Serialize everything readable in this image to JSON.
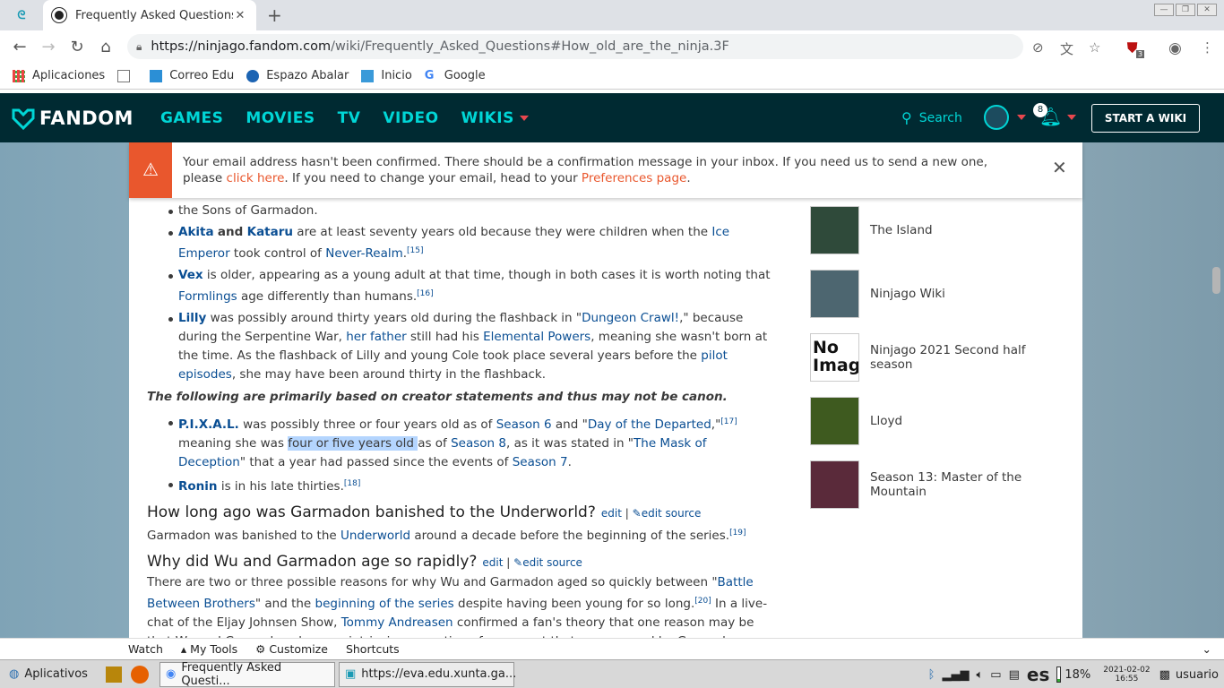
{
  "browser": {
    "tab_title": "Frequently Asked Questions",
    "url_host": "https://ninjago.fandom.com",
    "url_path": "/wiki/Frequently_Asked_Questions#How_old_are_the_ninja.3F",
    "ext_badge": "3"
  },
  "bookmarks": [
    {
      "label": "Aplicaciones"
    },
    {
      "label": ""
    },
    {
      "label": "Correo Edu"
    },
    {
      "label": "Espazo Abalar"
    },
    {
      "label": "Inicio"
    },
    {
      "label": "Google"
    }
  ],
  "fandom": {
    "logo": "FANDOM",
    "nav": [
      "GAMES",
      "MOVIES",
      "TV",
      "VIDEO",
      "WIKIS"
    ],
    "search": "Search",
    "notif_count": "8",
    "start_wiki": "START A WIKI"
  },
  "banner": {
    "text1": "Your email address hasn't been confirmed. There should be a confirmation message in your inbox. If you need us to send a new one, please ",
    "link1": "click here",
    "text2": ". If you need to change your email, head to your ",
    "link2": "Preferences page",
    "text3": "."
  },
  "article": {
    "top_line": "the Sons of Garmadon.",
    "akita": "Akita",
    "and": "and",
    "kataru": "Kataru",
    "akita_t1": " are at least seventy years old because they were children when the ",
    "ice_emperor": "Ice Emperor",
    "akita_t2": " took control of ",
    "never_realm": "Never-Realm",
    "akita_t3": ".",
    "ref15": "[15]",
    "vex": "Vex",
    "vex_t1": " is older, appearing as a young adult at that time, though in both cases it is worth noting that ",
    "formlings": "Formlings",
    "vex_t2": " age differently than humans.",
    "ref16": "[16]",
    "lilly": "Lilly",
    "lilly_t1": " was possibly around thirty years old during the flashback in \"",
    "dungeon": "Dungeon Crawl!",
    "lilly_t2": ",\" because during the Serpentine War, ",
    "her_father": "her father",
    "lilly_t3": " still had his ",
    "elemental": "Elemental Powers",
    "lilly_t4": ", meaning she wasn't born at the time. As the flashback of Lilly and young Cole took place several years before the ",
    "pilot": "pilot episodes",
    "lilly_t5": ", she may have been around thirty in the flashback.",
    "canon_note": "The following are primarily based on creator statements and thus may not be canon.",
    "pixal": "P.I.X.A.L.",
    "pixal_t1": " was possibly three or four years old as of ",
    "season6": "Season 6",
    "pixal_t2": " and \"",
    "day_departed": "Day of the Departed",
    "pixal_t3": ",\"",
    "ref17": "[17]",
    "pixal_t4": " meaning she was ",
    "highlight": "four or five years old ",
    "pixal_t5": "as of ",
    "season8": "Season 8",
    "pixal_t6": ", as it was stated in \"",
    "mask": "The Mask of Deception",
    "pixal_t7": "\" that a year had passed since the events of ",
    "season7": "Season 7",
    "pixal_t8": ".",
    "ronin": "Ronin",
    "ronin_t1": " is in his late thirties.",
    "ref18": "[18]",
    "h2_1": "How long ago was Garmadon banished to the Underworld?",
    "edit": "edit",
    "sep": "|",
    "edit_source": "edit source",
    "p1_t1": "Garmadon was banished to the ",
    "underworld": "Underworld",
    "p1_t2": " around a decade before the beginning of the series.",
    "ref19": "[19]",
    "h2_2": "Why did Wu and Garmadon age so rapidly?",
    "p2_t1": "There are two or three possible reasons for why Wu and Garmadon aged so quickly between \"",
    "battle": "Battle Between Brothers",
    "p2_t2": "\" and the ",
    "beginning": "beginning of the series",
    "p2_t3": " despite having been young for so long.",
    "ref20": "[20]",
    "p2_t4": " In a live-chat of the Eljay Johnsen Show, ",
    "tommy": "Tommy Andreasen",
    "p2_t5": " confirmed a fan's theory that one reason may be that Wu and Garmadon share an intrinsic connection of some sort that was severed by Garmadon being banished to the Underworld."
  },
  "rail": [
    {
      "label": "The Island",
      "color": "#2f4a3a"
    },
    {
      "label": "Ninjago Wiki",
      "color": "#4d6670"
    },
    {
      "label": "Ninjago 2021 Second half season",
      "thumb_text": "No Imag",
      "color": "#ffffff"
    },
    {
      "label": "Lloyd",
      "color": "#3e5a1f"
    },
    {
      "label": "Season 13: Master of the Mountain",
      "color": "#5a2a3a"
    }
  ],
  "bottombar": [
    "Watch",
    "My Tools",
    "Customize",
    "Shortcuts"
  ],
  "taskbar": {
    "start": "Aplicativos",
    "task1": "Frequently Asked Questi...",
    "task2": "https://eva.edu.xunta.ga...",
    "lang": "es",
    "battery": "18%",
    "date": "2021-02-02",
    "time": "16:55",
    "user": "usuario"
  }
}
